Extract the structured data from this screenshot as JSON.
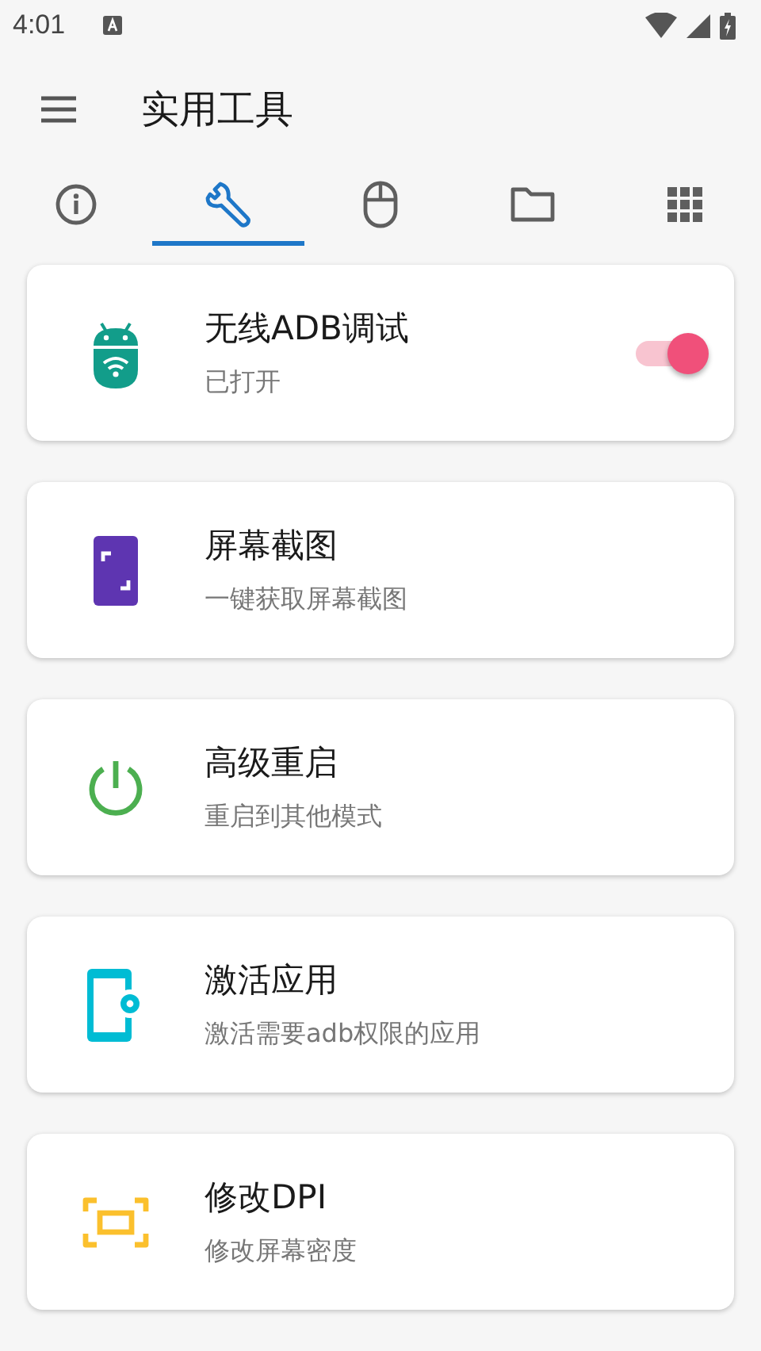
{
  "status_bar": {
    "time": "4:01"
  },
  "app_bar": {
    "title": "实用工具"
  },
  "tabs": [
    {
      "kind": "info",
      "selected": false
    },
    {
      "kind": "wrench",
      "selected": true
    },
    {
      "kind": "mouse",
      "selected": false
    },
    {
      "kind": "folder",
      "selected": false
    },
    {
      "kind": "apps",
      "selected": false
    }
  ],
  "tools": [
    {
      "color": "#129d8a",
      "title": "无线ADB调试",
      "subtitle": "已打开",
      "kind": "toggle",
      "on": true
    },
    {
      "color": "#5e35b1",
      "title": "屏幕截图",
      "subtitle": "一键获取屏幕截图",
      "kind": "plain"
    },
    {
      "color": "#4caf50",
      "title": "高级重启",
      "subtitle": "重启到其他模式",
      "kind": "plain"
    },
    {
      "color": "#00bcd4",
      "title": "激活应用",
      "subtitle": "激活需要adb权限的应用",
      "kind": "plain"
    },
    {
      "color": "#fbc02d",
      "title": "修改DPI",
      "subtitle": "修改屏幕密度",
      "kind": "plain"
    }
  ]
}
